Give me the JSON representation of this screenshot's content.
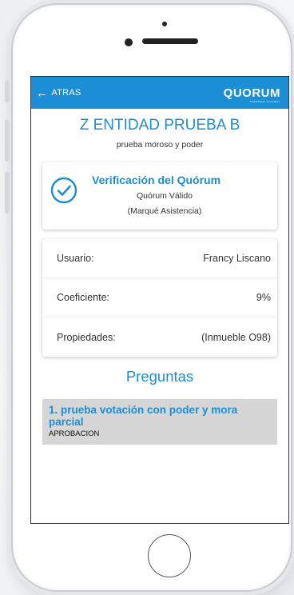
{
  "header": {
    "back_label": "ATRAS",
    "logo_text": "QUORUM",
    "logo_tagline": "Asambleas virtuales"
  },
  "entity": {
    "title": "Z ENTIDAD PRUEBA B",
    "subtitle": "prueba moroso y poder"
  },
  "verification": {
    "title": "Verificación del Quórum",
    "status": "Quórum Válido",
    "instruction": "(Marqué Asistencia)",
    "icon": "check-circle-icon"
  },
  "info": [
    {
      "label": "Usuario:",
      "value": "Francy Liscano"
    },
    {
      "label": "Coeficiente:",
      "value": "9%"
    },
    {
      "label": "Propiedades:",
      "value": "(Inmueble O98)"
    }
  ],
  "questions": {
    "title": "Preguntas",
    "items": [
      {
        "title": "1. prueba votación con poder y mora parcial",
        "type": "APROBACION"
      }
    ]
  },
  "colors": {
    "accent": "#1b8ed6",
    "card_gray": "#d6d6d6"
  }
}
